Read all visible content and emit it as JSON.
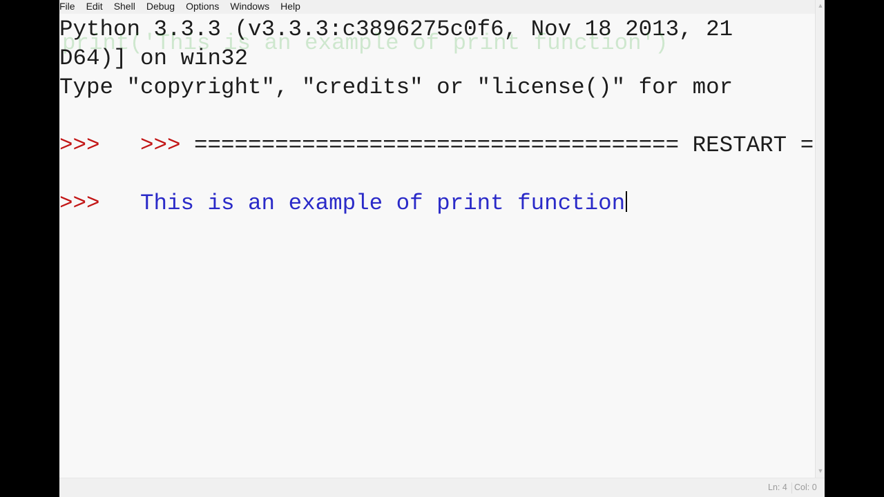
{
  "menu": {
    "items": [
      {
        "label": "File"
      },
      {
        "label": "Edit"
      },
      {
        "label": "Shell"
      },
      {
        "label": "Debug"
      },
      {
        "label": "Options"
      },
      {
        "label": "Windows"
      },
      {
        "label": "Help"
      }
    ]
  },
  "shell": {
    "ghost_overlay": "print('This is an example of print function')",
    "banner_line1": "Python 3.3.3 (v3.3.3:c3896275c0f6, Nov 18 2013, 21",
    "banner_line2": "D64)] on win32",
    "banner_line3": "Type \"copyright\", \"credits\" or \"license()\" for mor",
    "restart_prompt": ">>> ",
    "restart_text": "==================================== RESTART =====",
    "prompt_1": ">>> ",
    "output_text": "This is an example of print function",
    "prompt_2": ">>> "
  },
  "colors": {
    "prompt": "#c21515",
    "output": "#2a2ac8",
    "standard_text": "#1c1c1c"
  },
  "status": {
    "line": "Ln: 4",
    "col": "Col: 0"
  }
}
